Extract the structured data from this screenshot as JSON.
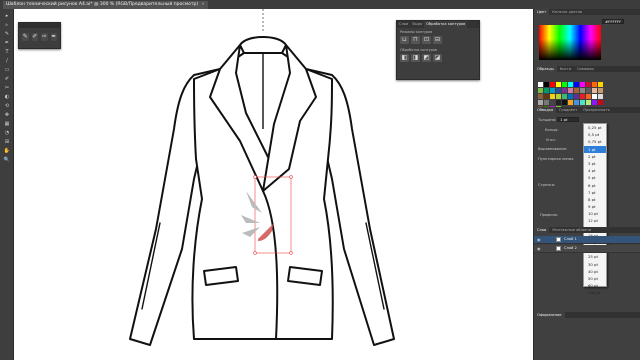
{
  "document": {
    "tab_title": "Шаблон технический рисунок А4.ai* @ 300 % (RGB/Предварительный просмотр)",
    "close": "×"
  },
  "toolbar": {
    "tools": [
      "▸",
      "▹",
      "✎",
      "✒",
      "T",
      "/",
      "▭",
      "✐",
      "✂",
      "◐",
      "⟲",
      "✥",
      "▦",
      "◔",
      "⊞",
      "✋",
      "🔍"
    ]
  },
  "right_top": {
    "tabs": [
      {
        "label": "Цвет",
        "active": true
      },
      {
        "label": "Каталог цветов",
        "active": false
      }
    ],
    "hex": "#FFFFFF"
  },
  "swatch_tabs": [
    {
      "label": "Образцы",
      "active": true
    },
    {
      "label": "Кисти",
      "active": false
    },
    {
      "label": "Символы",
      "active": false
    }
  ],
  "swatch_colors": [
    "#ffffff",
    "#000000",
    "#ff0000",
    "#ffff00",
    "#00ff00",
    "#00ffff",
    "#0000ff",
    "#ff00ff",
    "#c8102e",
    "#ff6a00",
    "#ffd400",
    "#7ac143",
    "#009966",
    "#00a0c6",
    "#2a4d9b",
    "#7b3294",
    "#d67aa2",
    "#a8623b",
    "#8a8a8a",
    "#5a5a5a",
    "#e6b8a2",
    "#c69c6d",
    "#8c6239",
    "#603813",
    "#f7d117",
    "#b3d334",
    "#3cb878",
    "#0072bc",
    "#662d91",
    "#ed1c24",
    "#f26522",
    "#ffffff",
    "#dddddd",
    "#aaaaaa",
    "#777777",
    "#444444",
    "#222222",
    "#111111",
    "#f5a623",
    "#4a90e2",
    "#50e3c2",
    "#b8e986",
    "#9013fe",
    "#d0021b",
    "#8b572a",
    "#417505",
    "#bd10e0",
    "#7ed321"
  ],
  "stroke_panel": {
    "tabs": [
      {
        "label": "Обводка",
        "active": true
      },
      {
        "label": "Градиент",
        "active": false
      },
      {
        "label": "Прозрачность",
        "active": false
      }
    ],
    "weight_label": "Толщина:",
    "weight_value": "1 pt",
    "cap_label": "Концы:",
    "corner_label": "Угол:",
    "align_label": "Выравнивание:",
    "dashed_label": "Пунктирная линия",
    "arrow_label": "Стрелки:",
    "profile_label": "Профиль:"
  },
  "weight_options": [
    {
      "label": "0,25 pt",
      "selected": false
    },
    {
      "label": "0,5 pt",
      "selected": false
    },
    {
      "label": "0,75 pt",
      "selected": false
    },
    {
      "label": "1 pt",
      "selected": true
    },
    {
      "label": "2 pt",
      "selected": false
    },
    {
      "label": "3 pt",
      "selected": false
    },
    {
      "label": "4 pt",
      "selected": false
    },
    {
      "label": "5 pt",
      "selected": false
    },
    {
      "label": "6 pt",
      "selected": false
    },
    {
      "label": "7 pt",
      "selected": false
    },
    {
      "label": "8 pt",
      "selected": false
    },
    {
      "label": "9 pt",
      "selected": false
    },
    {
      "label": "10 pt",
      "selected": false
    },
    {
      "label": "12 pt",
      "selected": false
    },
    {
      "label": "14 pt",
      "selected": false
    },
    {
      "label": "16 pt",
      "selected": false
    },
    {
      "label": "18 pt",
      "selected": false
    },
    {
      "label": "20 pt",
      "selected": false
    },
    {
      "label": "25 pt",
      "selected": false
    },
    {
      "label": "30 pt",
      "selected": false
    },
    {
      "label": "40 pt",
      "selected": false
    },
    {
      "label": "50 pt",
      "selected": false
    },
    {
      "label": "60 pt",
      "selected": false
    },
    {
      "label": "100 pt",
      "selected": false
    }
  ],
  "pathfinder": {
    "tabs": [
      {
        "label": "Слои",
        "active": false
      },
      {
        "label": "Выра",
        "active": false
      },
      {
        "label": "Обработка контуров",
        "active": true
      }
    ],
    "shape_modes": "Режимы контуров",
    "pathfinders": "Обработка контуров",
    "mode_icons": [
      "⊔",
      "⊓",
      "⊡",
      "⊟"
    ],
    "pf_icons": [
      "◧",
      "◨",
      "◩",
      "◪"
    ]
  },
  "brush_panel": {
    "icons": [
      "✎",
      "✐",
      "✑",
      "✒"
    ]
  },
  "layers": {
    "tabs": [
      {
        "label": "Слои",
        "active": true
      },
      {
        "label": "Монтажные области",
        "active": false
      }
    ],
    "rows": [
      {
        "name": "Слой 1",
        "active": true
      },
      {
        "name": "Слой 2",
        "active": false
      }
    ]
  },
  "appearance_tab": "Оформление"
}
